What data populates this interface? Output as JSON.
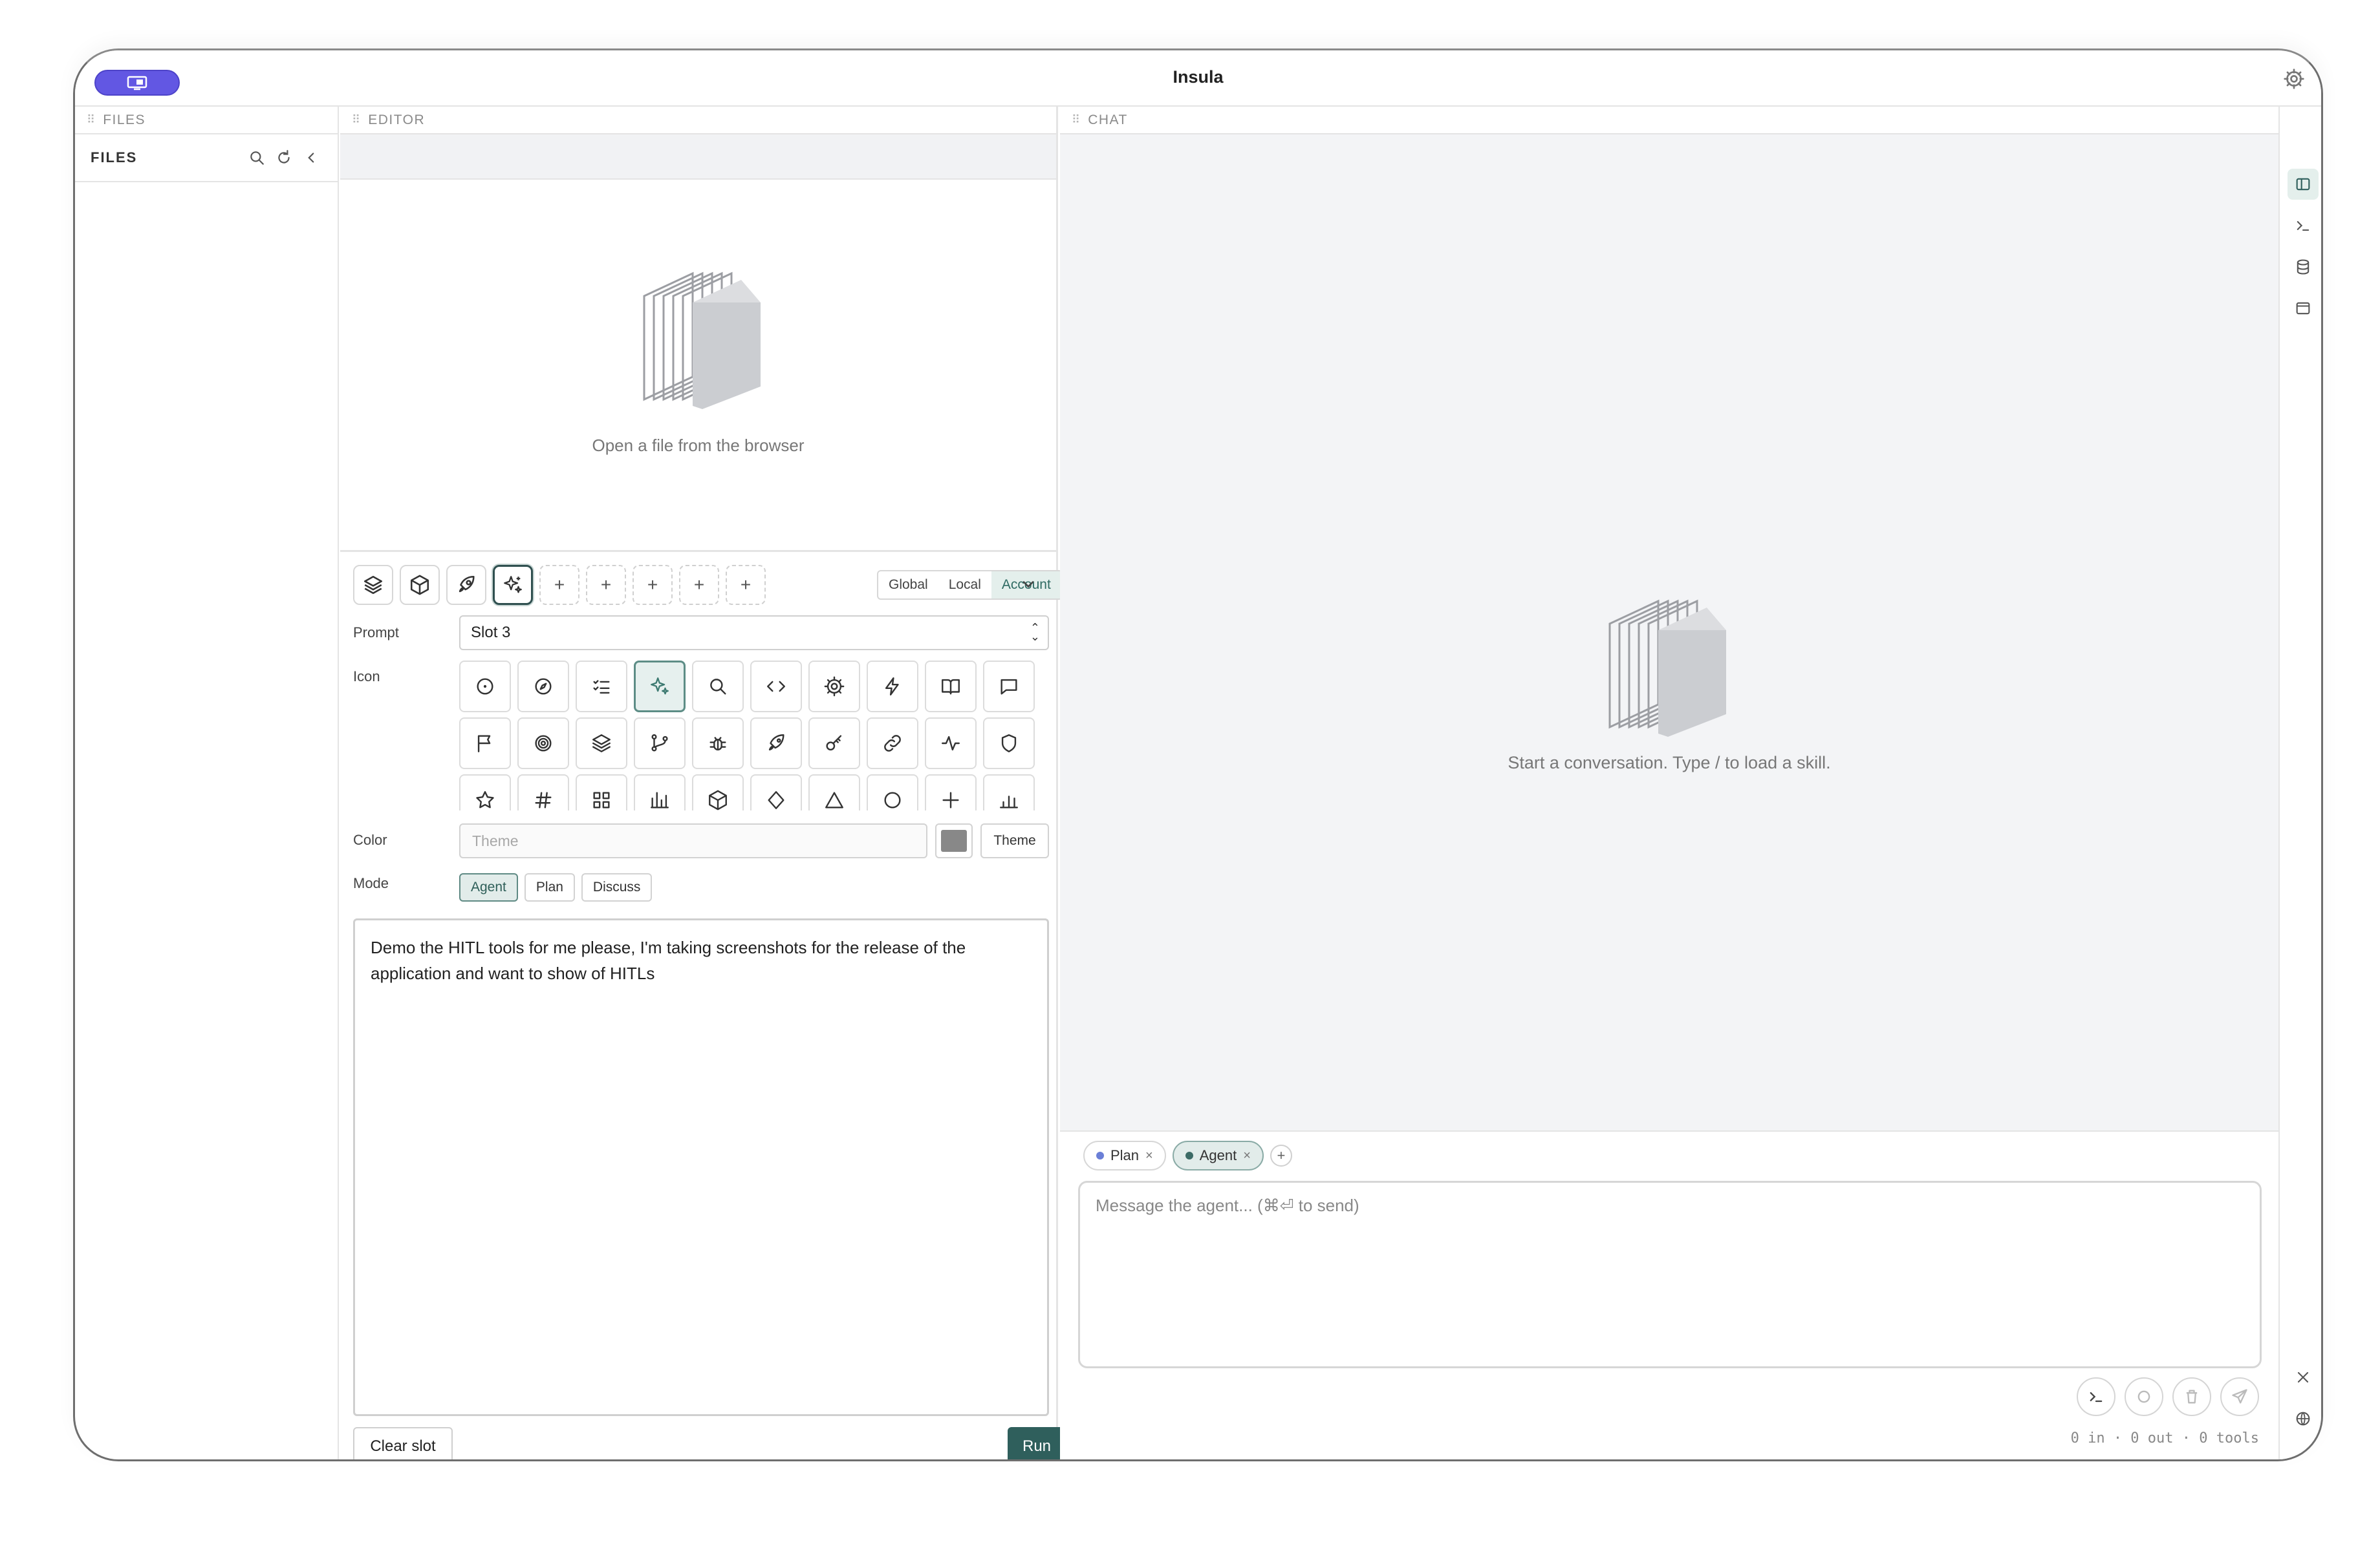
{
  "window": {
    "title": "Insula"
  },
  "files": {
    "panel_label": "FILES",
    "header": "FILES"
  },
  "editor": {
    "panel_label": "EDITOR",
    "empty_message": "Open a file from the browser"
  },
  "prompt": {
    "scopes": [
      "Global",
      "Local",
      "Account"
    ],
    "selected_scope": "Account",
    "labels": {
      "prompt": "Prompt",
      "icon": "Icon",
      "color": "Color",
      "mode": "Mode"
    },
    "slot_value": "Slot 3",
    "color_placeholder": "Theme",
    "color_swatch": "#888888",
    "theme_button": "Theme",
    "modes": [
      "Agent",
      "Plan",
      "Discuss"
    ],
    "selected_mode": "Agent",
    "text": "Demo the HITL tools for me please, I'm taking screenshots for the release of the application and want to show of HITLs",
    "clear_label": "Clear slot",
    "run_label": "Run"
  },
  "slots": [
    "layers-icon",
    "box-icon",
    "rocket-icon",
    "sparkles-icon",
    "add",
    "add",
    "add",
    "add",
    "add"
  ],
  "icon_grid": [
    "circle-dot-icon",
    "compass-icon",
    "list-checks-icon",
    "sparkles-icon",
    "search-icon",
    "code-icon",
    "gear-icon",
    "zap-icon",
    "book-open-icon",
    "message-square-icon",
    "flag-icon",
    "target-icon",
    "layers-icon",
    "git-branch-icon",
    "bug-icon",
    "rocket-icon",
    "key-icon",
    "link-icon",
    "activity-icon",
    "shield-icon",
    "star-icon",
    "hash-icon",
    "grid-icon",
    "chart-icon",
    "package-icon",
    "diamond-icon",
    "triangle-icon",
    "circle-icon",
    "plus-icon",
    "bar-chart-icon"
  ],
  "chat": {
    "panel_label": "CHAT",
    "empty_message": "Start a conversation. Type / to load a skill.",
    "tabs": [
      {
        "label": "Plan",
        "dot": "#6b7fd7"
      },
      {
        "label": "Agent",
        "dot": "#3d6b66"
      }
    ],
    "input_placeholder": "Message the agent... (⌘⏎ to send)",
    "token_info": "0 in · 0 out · 0 tools"
  },
  "colors": {
    "accent": "#2f5f5c",
    "brand": "#6257e3",
    "selected_bg": "#e2ecea"
  }
}
